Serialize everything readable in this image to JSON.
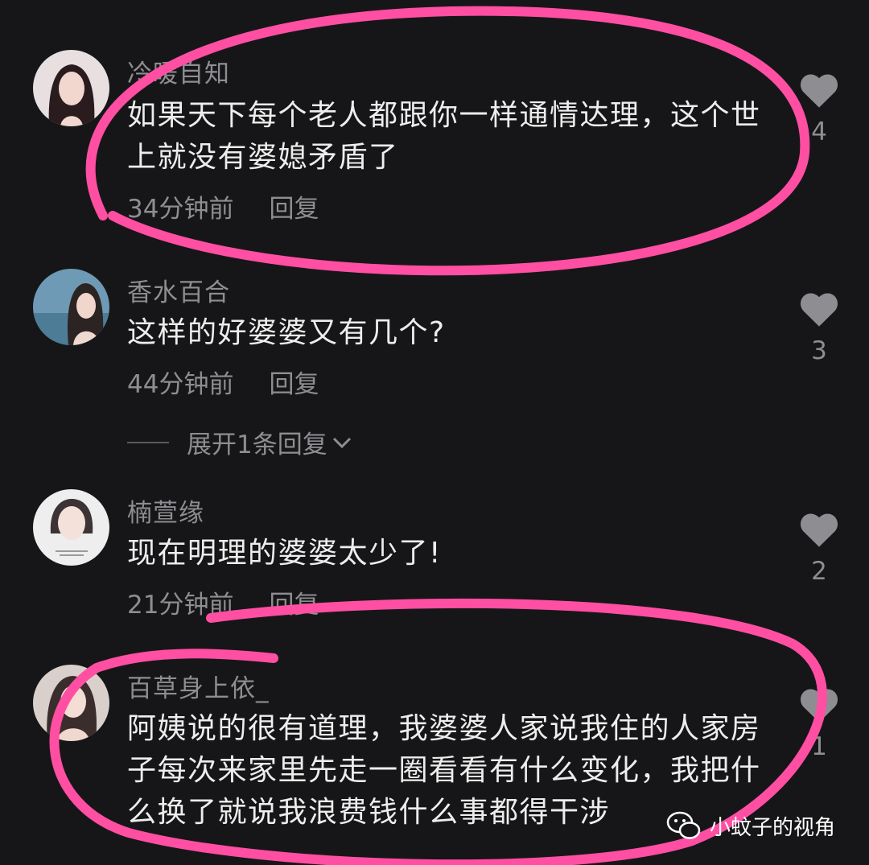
{
  "comments": [
    {
      "username": "冷暖自知",
      "text": "如果天下每个老人都跟你一样通情达理，这个世上就没有婆媳矛盾了",
      "time": "34分钟前",
      "reply": "回复",
      "likes": "4",
      "avatar_icon": "avatar-photo"
    },
    {
      "username": "香水百合",
      "text": "这样的好婆婆又有几个?",
      "time": "44分钟前",
      "reply": "回复",
      "likes": "3",
      "avatar_icon": "avatar-photo"
    },
    {
      "username": "楠萱缘",
      "text": "现在明理的婆婆太少了!",
      "time": "21分钟前",
      "reply": "回复",
      "likes": "2",
      "avatar_icon": "avatar-photo"
    },
    {
      "username": "百草身上依_",
      "text": "阿姨说的很有道理，我婆婆人家说我住的人家房子每次来家里先走一圈看看有什么变化，我把什么换了就说我浪费钱什么事都得干涉",
      "likes": "1",
      "avatar_icon": "avatar-photo"
    }
  ],
  "expand_replies": "展开1条回复",
  "watermark": "小蚊子的视角",
  "colors": {
    "background": "#161618",
    "annotation": "#ff4fa3",
    "secondary_text": "#8e8e92",
    "primary_text": "#ededed"
  }
}
